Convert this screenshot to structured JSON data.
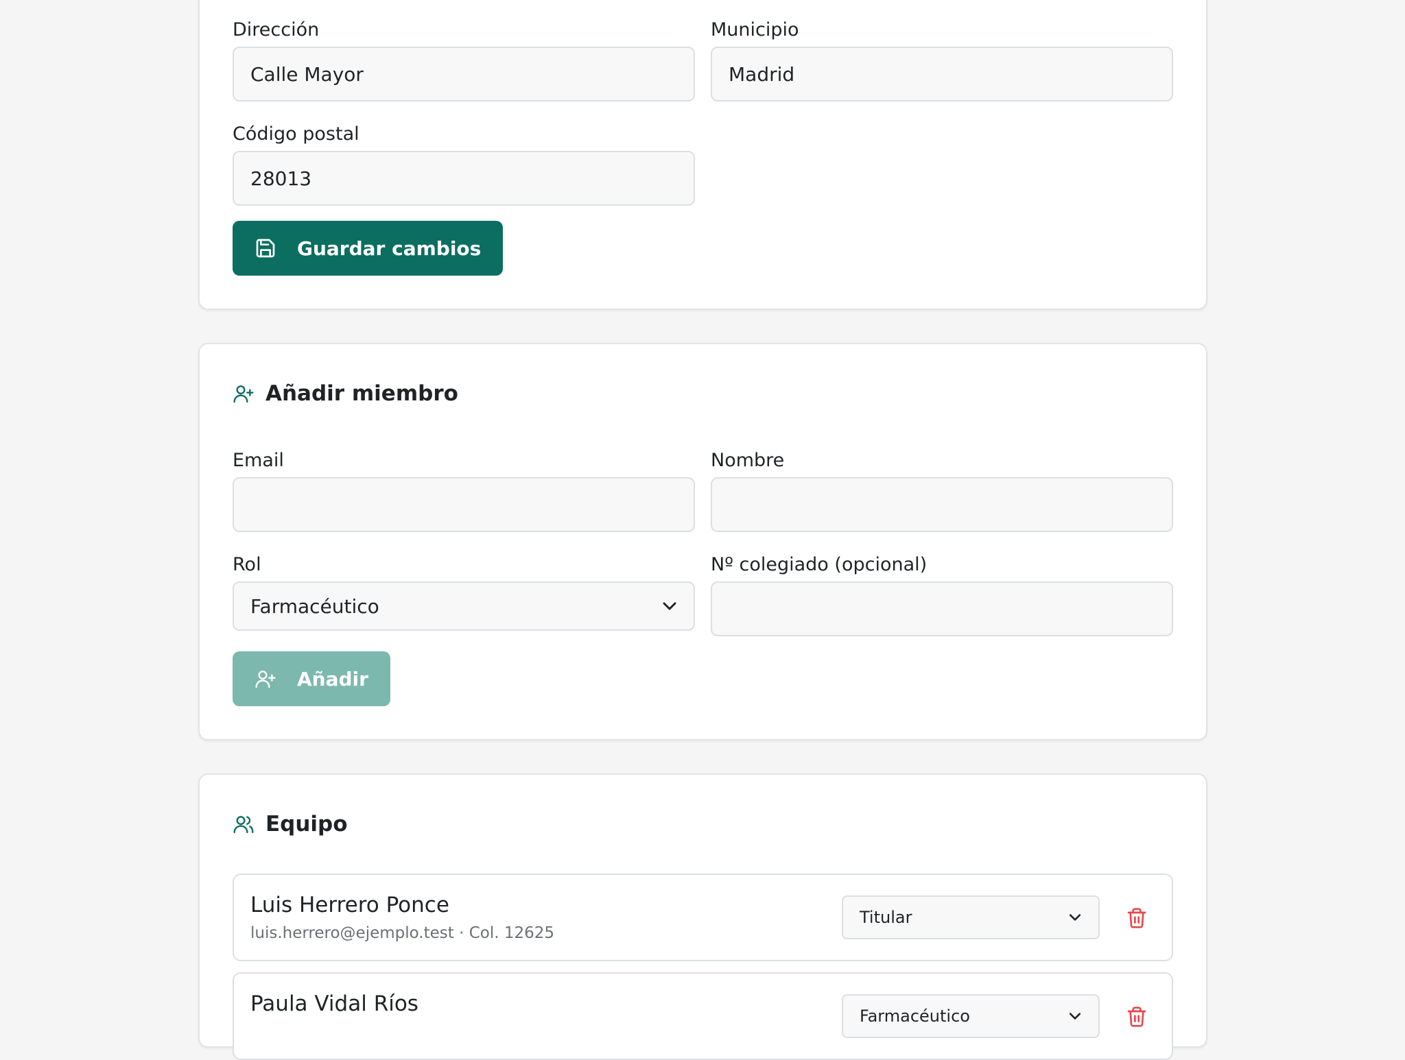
{
  "address_card": {
    "direccion_label": "Dirección",
    "direccion_value": "Calle Mayor",
    "municipio_label": "Municipio",
    "municipio_value": "Madrid",
    "codigo_postal_label": "Código postal",
    "codigo_postal_value": "28013",
    "save_label": "Guardar cambios"
  },
  "add_member_card": {
    "title": "Añadir miembro",
    "email_label": "Email",
    "email_value": "",
    "nombre_label": "Nombre",
    "nombre_value": "",
    "rol_label": "Rol",
    "rol_selected": "Farmacéutico",
    "colegiado_label": "Nº colegiado (opcional)",
    "colegiado_value": "",
    "add_label": "Añadir"
  },
  "team_card": {
    "title": "Equipo",
    "members": [
      {
        "name": "Luis Herrero Ponce",
        "meta": "luis.herrero@ejemplo.test · Col. 12625",
        "role": "Titular"
      },
      {
        "name": "Paula Vidal Ríos",
        "meta": "",
        "role": "Farmacéutico"
      }
    ]
  },
  "colors": {
    "primary": "#0c6e60",
    "primary_disabled": "#7db8ae",
    "danger": "#e5484d",
    "border": "#dcdfe2"
  },
  "icons": {
    "save": "save-icon",
    "user_plus": "user-plus-icon",
    "users": "users-icon",
    "chevron": "chevron-down-icon",
    "trash": "trash-icon"
  }
}
